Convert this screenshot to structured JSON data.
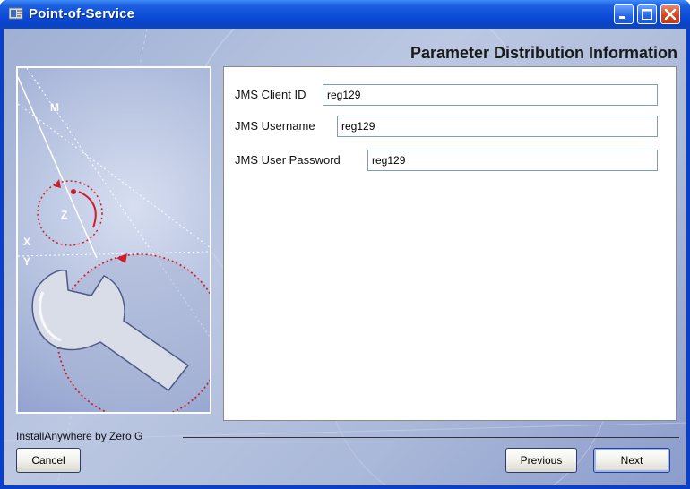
{
  "window": {
    "title": "Point-of-Service"
  },
  "title_bar_buttons": {
    "minimize_icon": "minimize-icon",
    "maximize_icon": "maximize-icon",
    "close_icon": "close-icon"
  },
  "page": {
    "heading": "Parameter Distribution Information"
  },
  "form": {
    "fields": [
      {
        "label": "JMS Client ID",
        "value": "reg129"
      },
      {
        "label": "JMS Username",
        "value": "reg129"
      },
      {
        "label": "JMS User Password",
        "value": "reg129"
      }
    ]
  },
  "side_art": {
    "axis_labels": [
      "M",
      "Z",
      "X",
      "Y"
    ]
  },
  "footer": {
    "vendor": "InstallAnywhere by Zero G",
    "cancel_label": "Cancel",
    "previous_label": "Previous",
    "next_label": "Next"
  },
  "colors": {
    "title_bar": "#0a43c8",
    "close_button": "#d2471e",
    "accent_red": "#cc1f2b"
  }
}
